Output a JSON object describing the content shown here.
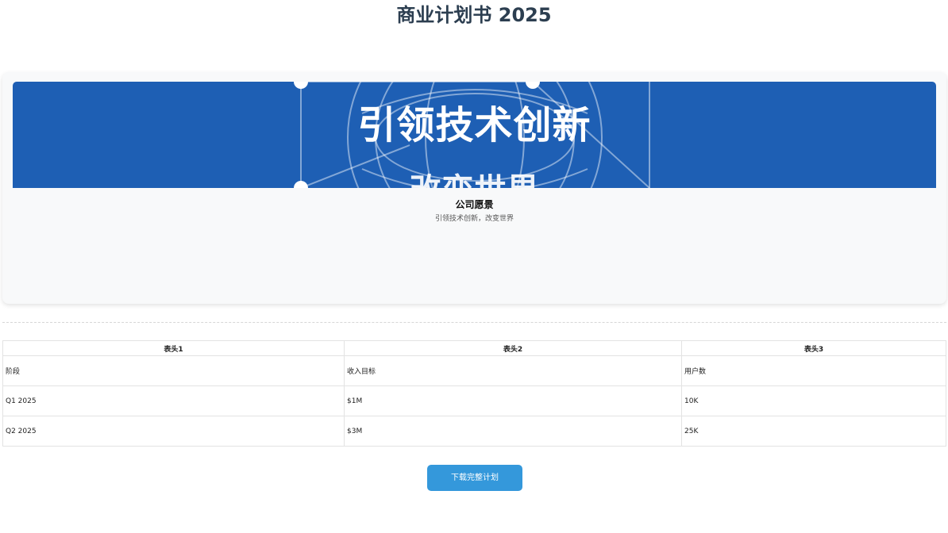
{
  "page": {
    "title": "商业计划书 2025"
  },
  "vision_card": {
    "banner_text_line1": "引领技术创新",
    "banner_text_line2": "改变世界",
    "banner_color": "#1e5fb4",
    "title": "公司愿景",
    "description": "引领技术创新，改变世界"
  },
  "plan_table": {
    "headers": [
      "表头1",
      "表头2",
      "表头3"
    ],
    "rows": [
      [
        "阶段",
        "收入目标",
        "用户数"
      ],
      [
        "Q1 2025",
        "$1M",
        "10K"
      ],
      [
        "Q2 2025",
        "$3M",
        "25K"
      ]
    ]
  },
  "actions": {
    "download_label": "下载完整计划",
    "button_color": "#3498db"
  }
}
